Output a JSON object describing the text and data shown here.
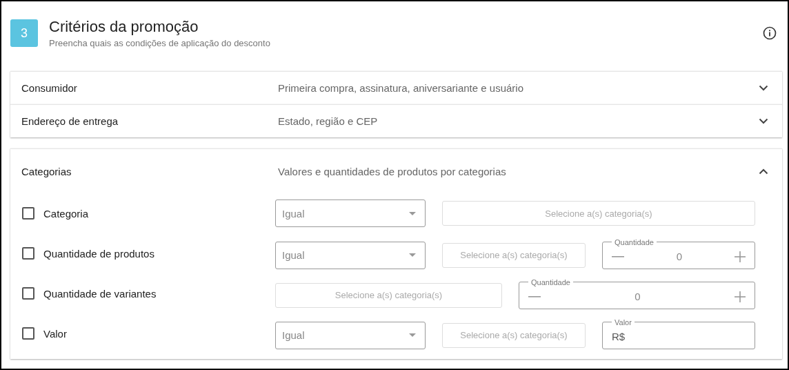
{
  "header": {
    "step": "3",
    "title": "Critérios da promoção",
    "subtitle": "Preencha quais as condições de aplicação do desconto"
  },
  "sections": [
    {
      "title": "Consumidor",
      "summary": "Primeira compra, assinatura, aniversariante e usuário",
      "expanded": false
    },
    {
      "title": "Endereço de entrega",
      "summary": "Estado, região e CEP",
      "expanded": false
    },
    {
      "title": "Categorias",
      "summary": "Valores e quantidades de produtos por categorias",
      "expanded": true,
      "criteria": [
        {
          "label": "Categoria",
          "checked": false,
          "controls": [
            {
              "kind": "select",
              "value": "Igual"
            },
            {
              "kind": "category",
              "text": "Selecione a(s) categoria(s)"
            }
          ]
        },
        {
          "label": "Quantidade de produtos",
          "checked": false,
          "controls": [
            {
              "kind": "select",
              "value": "Igual"
            },
            {
              "kind": "category",
              "text": "Selecione a(s) categoria(s)"
            },
            {
              "kind": "stepper",
              "label": "Quantidade",
              "value": "0"
            }
          ]
        },
        {
          "label": "Quantidade de variantes",
          "checked": false,
          "controls": [
            {
              "kind": "category",
              "text": "Selecione a(s) categoria(s)"
            },
            {
              "kind": "stepper",
              "label": "Quantidade",
              "value": "0"
            }
          ]
        },
        {
          "label": "Valor",
          "checked": false,
          "controls": [
            {
              "kind": "select",
              "value": "Igual"
            },
            {
              "kind": "category",
              "text": "Selecione a(s) categoria(s)"
            },
            {
              "kind": "money",
              "label": "Valor",
              "value": "R$"
            }
          ]
        }
      ]
    }
  ]
}
